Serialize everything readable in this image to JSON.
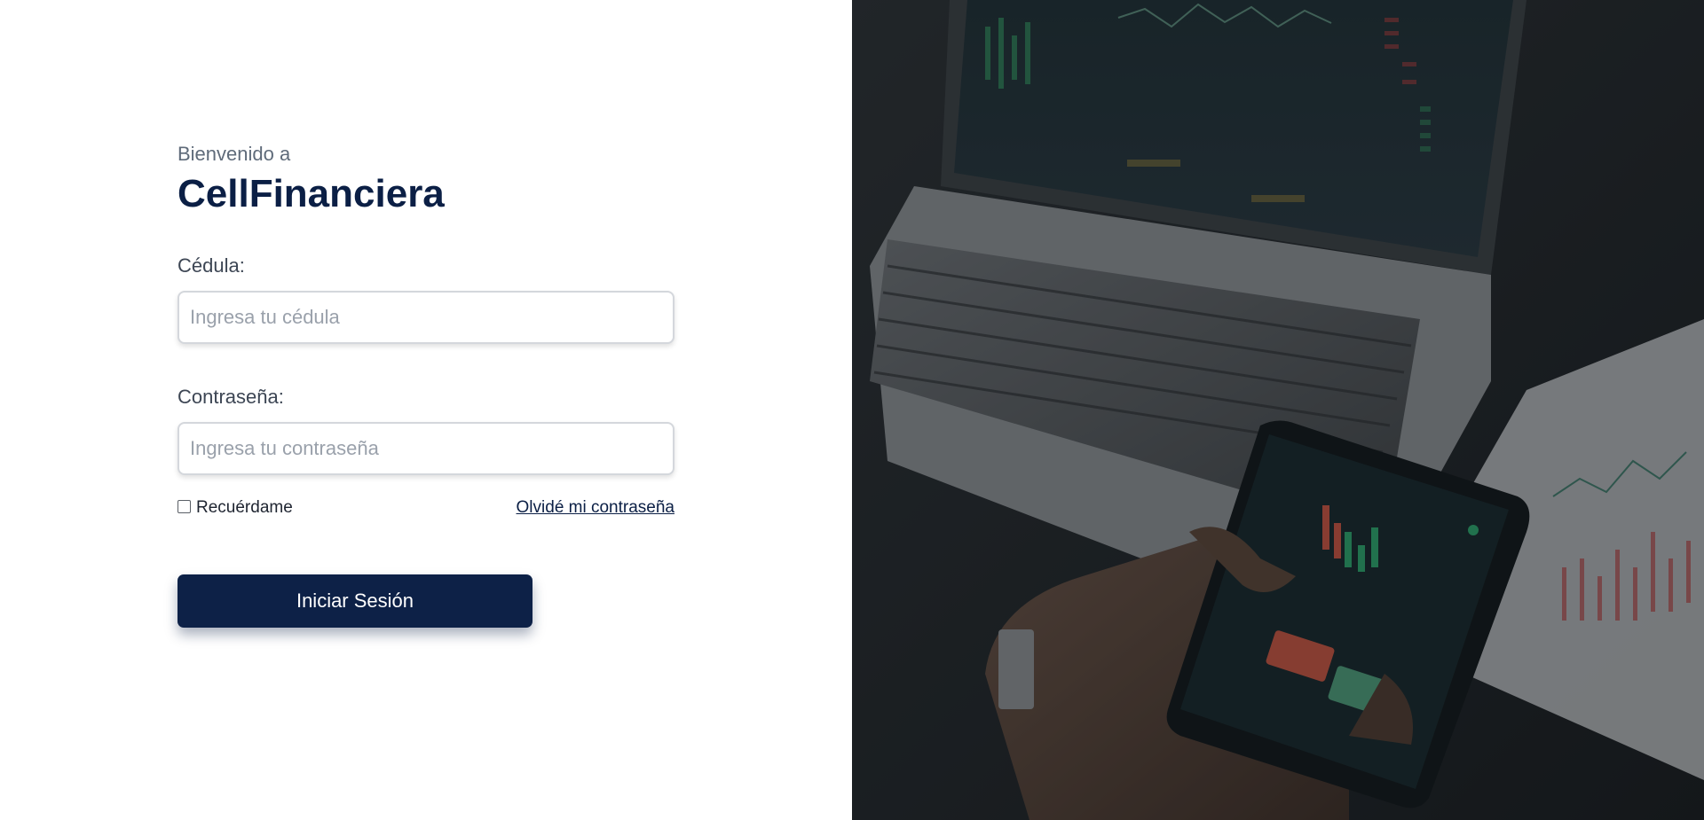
{
  "header": {
    "welcome": "Bienvenido a",
    "brand": "CellFinanciera"
  },
  "form": {
    "id_label": "Cédula:",
    "id_placeholder": "Ingresa tu cédula",
    "id_value": "",
    "password_label": "Contraseña:",
    "password_placeholder": "Ingresa tu contraseña",
    "password_value": "",
    "remember_label": "Recuérdame",
    "remember_checked": false,
    "forgot_link": "Olvidé mi contraseña",
    "submit_label": "Iniciar Sesión"
  },
  "colors": {
    "brand_navy": "#0d2147",
    "label_gray": "#5f6b7a",
    "image_overlay": "#1f2326"
  },
  "hero_image": {
    "icon": "trading-photo",
    "description_icons": [
      "laptop-icon",
      "smartphone-icon",
      "chart-icon"
    ]
  }
}
